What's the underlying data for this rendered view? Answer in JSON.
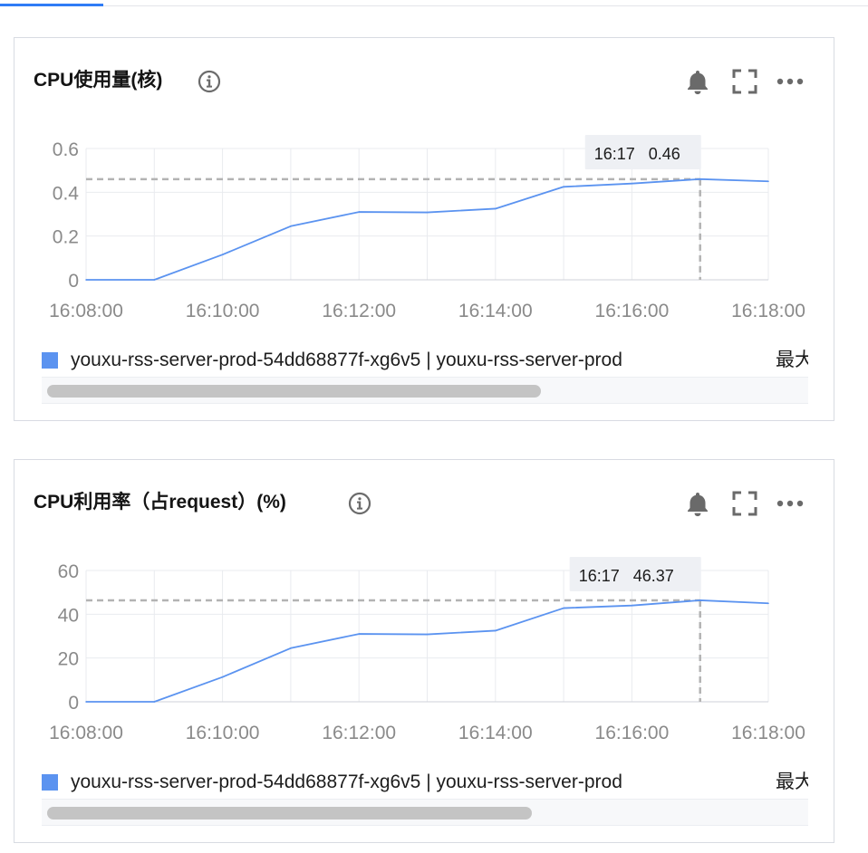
{
  "colors": {
    "line": "#5b93f0",
    "grid": "#e9ebef",
    "axis_text": "#8a8a8a",
    "crosshair": "#b3b3b3",
    "tooltip_bg": "#eef0f4"
  },
  "icons": [
    "info-icon",
    "bell-icon",
    "fullscreen-icon",
    "more-icon"
  ],
  "panels": [
    {
      "title": "CPU使用量(核)",
      "tooltip": {
        "time": "16:17",
        "value": "0.46"
      },
      "legend": {
        "label": "youxu-rss-server-prod-54dd68877f-xg6v5 | youxu-rss-server-prod",
        "extra": "最大"
      }
    },
    {
      "title": "CPU利用率（占request）(%)",
      "tooltip": {
        "time": "16:17",
        "value": "46.37"
      },
      "legend": {
        "label": "youxu-rss-server-prod-54dd68877f-xg6v5 | youxu-rss-server-prod",
        "extra": "最大"
      }
    }
  ],
  "chart_data": [
    {
      "type": "line",
      "title": "CPU使用量(核)",
      "xlabel": "",
      "ylabel": "",
      "x_ticks": [
        "16:08:00",
        "16:10:00",
        "16:12:00",
        "16:14:00",
        "16:16:00",
        "16:18:00"
      ],
      "y_ticks": [
        "0",
        "0.2",
        "0.4",
        "0.6"
      ],
      "xlim": [
        "16:08:00",
        "16:18:00"
      ],
      "ylim": [
        0,
        0.6
      ],
      "grid": true,
      "legend": "bottom",
      "series": [
        {
          "name": "youxu-rss-server-prod-54dd68877f-xg6v5 | youxu-rss-server-prod",
          "x": [
            "16:08:00",
            "16:09:00",
            "16:10:00",
            "16:11:00",
            "16:12:00",
            "16:13:00",
            "16:14:00",
            "16:15:00",
            "16:16:00",
            "16:17:00",
            "16:18:00"
          ],
          "values": [
            0.0,
            0.0,
            0.115,
            0.245,
            0.31,
            0.308,
            0.325,
            0.425,
            0.44,
            0.46,
            0.45
          ]
        }
      ],
      "crosshair": {
        "x": "16:17:00",
        "y": 0.46
      }
    },
    {
      "type": "line",
      "title": "CPU利用率（占request）(%)",
      "xlabel": "",
      "ylabel": "",
      "x_ticks": [
        "16:08:00",
        "16:10:00",
        "16:12:00",
        "16:14:00",
        "16:16:00",
        "16:18:00"
      ],
      "y_ticks": [
        "0",
        "20",
        "40",
        "60"
      ],
      "xlim": [
        "16:08:00",
        "16:18:00"
      ],
      "ylim": [
        0,
        60
      ],
      "grid": true,
      "legend": "bottom",
      "series": [
        {
          "name": "youxu-rss-server-prod-54dd68877f-xg6v5 | youxu-rss-server-prod",
          "x": [
            "16:08:00",
            "16:09:00",
            "16:10:00",
            "16:11:00",
            "16:12:00",
            "16:13:00",
            "16:14:00",
            "16:15:00",
            "16:16:00",
            "16:17:00",
            "16:18:00"
          ],
          "values": [
            0.0,
            0.0,
            11.3,
            24.5,
            31.0,
            30.8,
            32.5,
            42.8,
            44.0,
            46.37,
            45.0
          ]
        }
      ],
      "crosshair": {
        "x": "16:17:00",
        "y": 46.37
      }
    }
  ]
}
